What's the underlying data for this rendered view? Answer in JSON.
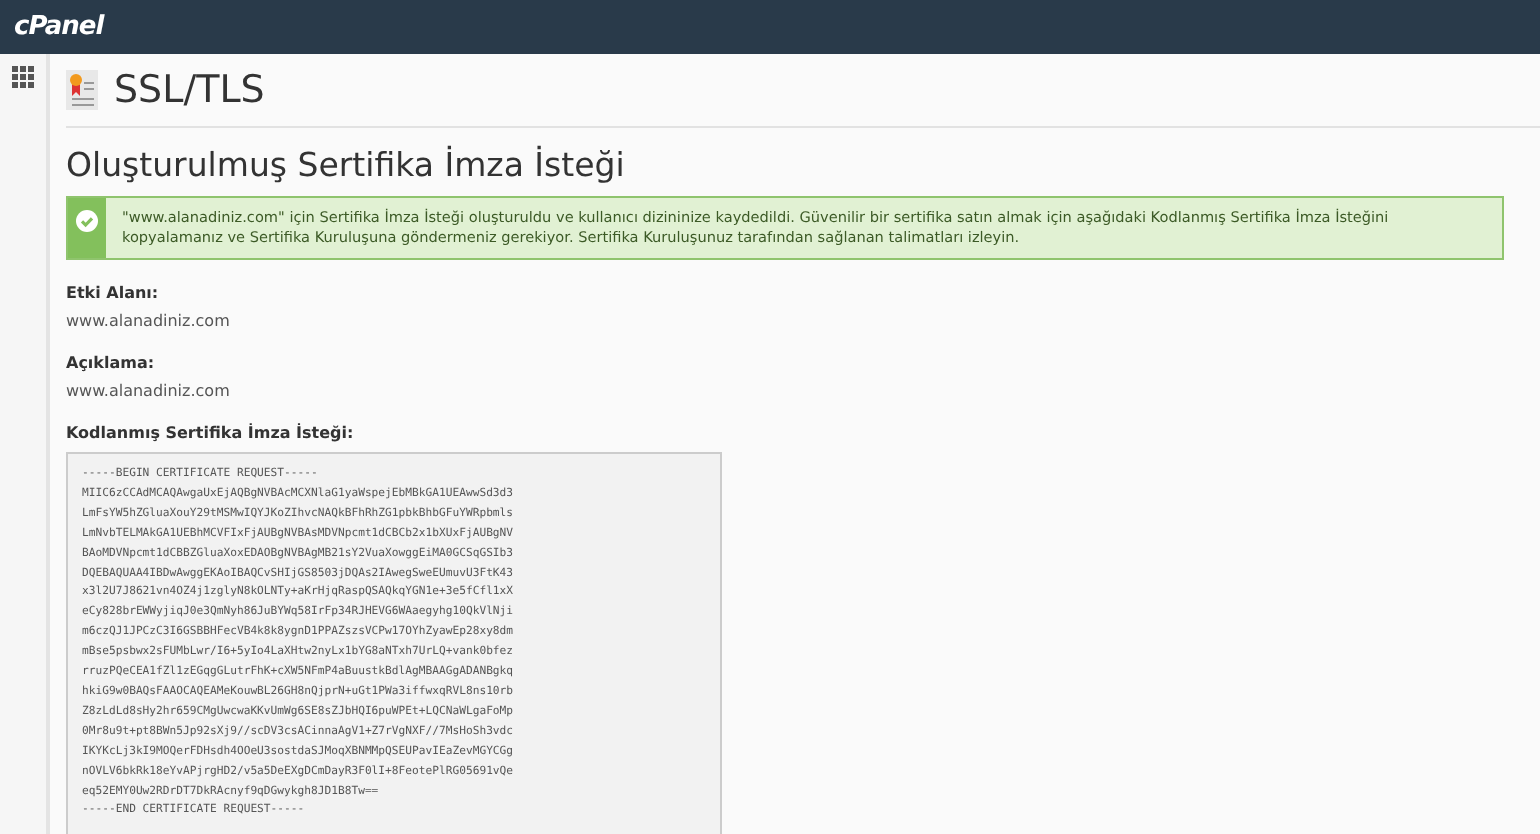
{
  "topbar": {
    "logo": "cPanel"
  },
  "header": {
    "title": "SSL/TLS"
  },
  "page": {
    "heading": "Oluşturulmuş Sertifika İmza İsteği",
    "alert": {
      "kind": "success",
      "text": "\"www.alanadiniz.com\" için Sertifika İmza İsteği oluşturuldu ve kullanıcı dizininize kaydedildi. Güvenilir bir sertifika satın almak için aşağıdaki Kodlanmış Sertifika İmza İsteğini kopyalamanız ve Sertifika Kuruluşuna göndermeniz gerekiyor. Sertifika Kuruluşunuz tarafından sağlanan talimatları izleyin."
    },
    "fields": [
      {
        "label": "Etki Alanı:",
        "value": "www.alanadiniz.com"
      },
      {
        "label": "Açıklama:",
        "value": "www.alanadiniz.com"
      }
    ],
    "csr": {
      "label": "Kodlanmış Sertifika İmza İsteği:",
      "lines": [
        "-----BEGIN CERTIFICATE REQUEST-----",
        "MIIC6zCCAdMCAQAwgaUxEjAQBgNVBAcMCXNlaG1yaWspejEbMBkGA1UEAwwSd3d3",
        "LmFsYW5hZGluaXouY29tMSMwIQYJKoZIhvcNAQkBFhRhZG1pbkBhbGFuYWRpbmls",
        "LmNvbTELMAkGA1UEBhMCVFIxFjAUBgNVBAsMDVNpcmt1dCBCb2x1bXUxFjAUBgNV",
        "BAoMDVNpcmt1dCBBZGluaXoxEDAOBgNVBAgMB21sY2VuaXowggEiMA0GCSqGSIb3",
        "DQEBAQUAA4IBDwAwggEKAoIBAQCvSHIjGS8503jDQAs2IAwegSweEUmuvU3FtK43",
        "x3l2U7J8621vn4OZ4j1zglyN8kOLNTy+aKrHjqRaspQSAQkqYGN1e+3e5fCfl1xX",
        "eCy828brEWWyjiqJ0e3QmNyh86JuBYWq58IrFp34RJHEVG6WAaegyhg10QkVlNji",
        "m6czQJ1JPCzC3I6GSBBHFecVB4k8k8ygnD1PPAZszsVCPw17OYhZyawEp28xy8dm",
        "mBse5psbwx2sFUMbLwr/I6+5yIo4LaXHtw2nyLx1bYG8aNTxh7UrLQ+vank0bfez",
        "rruzPQeCEA1fZl1zEGqgGLutrFhK+cXW5NFmP4aBuustkBdlAgMBAAGgADANBgkq",
        "hkiG9w0BAQsFAAOCAQEAMeKouwBL26GH8nQjprN+uGt1PWa3iffwxqRVL8ns10rb",
        "Z8zLdLd8sHy2hr659CMgUwcwaKKvUmWg6SE8sZJbHQI6puWPEt+LQCNaWLgaFoMp",
        "0Mr8u9t+pt8BWn5Jp92sXj9//scDV3csACinnaAgV1+Z7rVgNXF//7MsHoSh3vdc",
        "IKYKcLj3kI9MOQerFDHsdh4OOeU3sostdaSJMoqXBNMMpQSEUPavIEaZevMGYCGg",
        "nOVLV6bkRk18eYvAPjrgHD2/v5a5DeEXgDCmDayR3F0lI+8FeotePlRG05691vQe",
        "eq52EMY0Uw2RDrDT7DkRAcnyf9qDGwykgh8JD1B8Tw==",
        "-----END CERTIFICATE REQUEST-----"
      ]
    }
  }
}
